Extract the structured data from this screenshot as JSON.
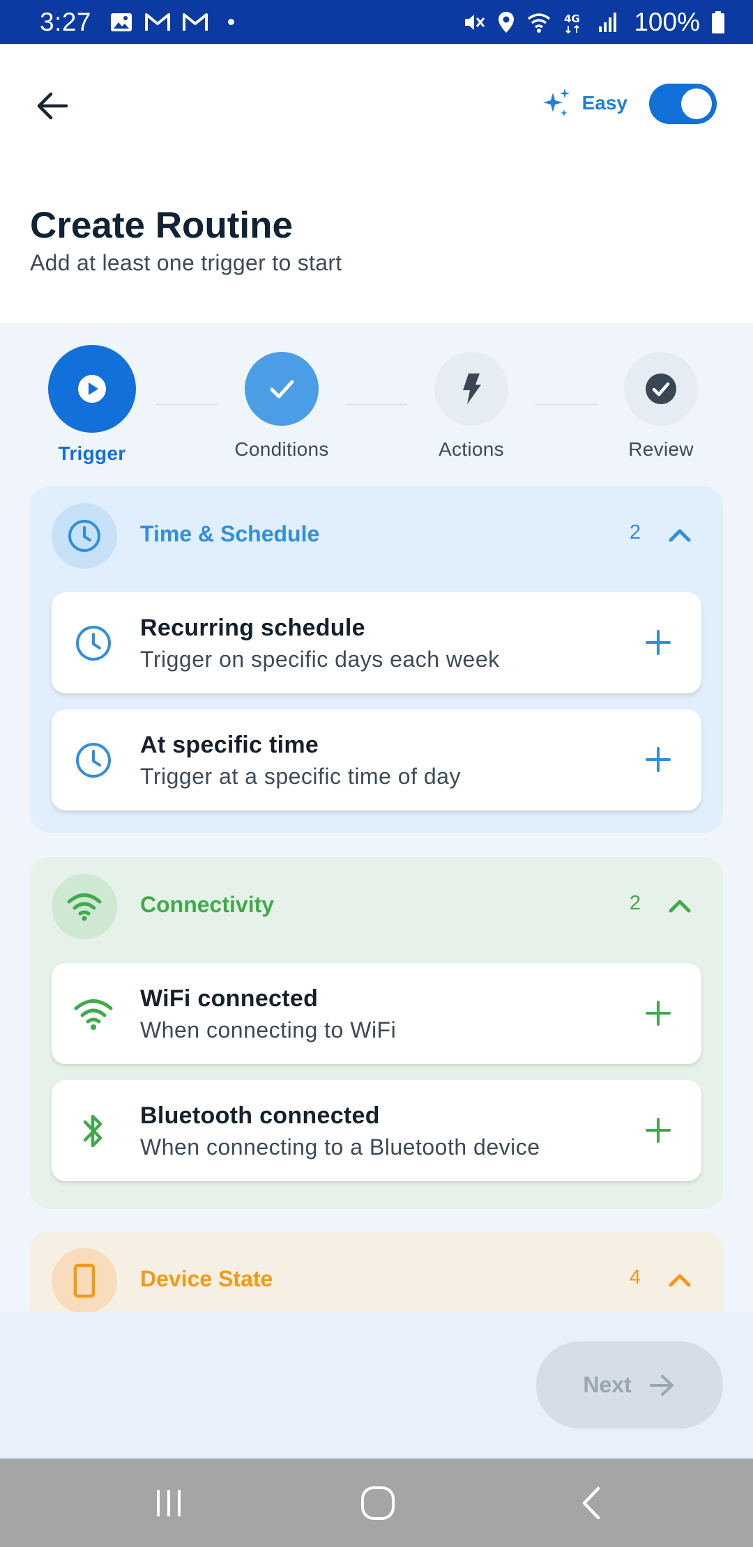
{
  "status_bar": {
    "time": "3:27",
    "battery": "100%",
    "icons": [
      "image-icon",
      "gmail-icon",
      "gmail-icon",
      "dot",
      "mute-icon",
      "location-icon",
      "wifi-icon",
      "4g-icon",
      "signal-icon",
      "battery-icon"
    ]
  },
  "header": {
    "easy_label": "Easy",
    "easy_toggle_on": true,
    "title": "Create Routine",
    "subtitle": "Add at least one trigger to start"
  },
  "stepper": {
    "steps": [
      {
        "label": "Trigger",
        "state": "active",
        "icon": "play-icon"
      },
      {
        "label": "Conditions",
        "state": "done",
        "icon": "check-icon"
      },
      {
        "label": "Actions",
        "state": "pending",
        "icon": "bolt-icon"
      },
      {
        "label": "Review",
        "state": "pending",
        "icon": "check-circle-icon"
      }
    ]
  },
  "sections": [
    {
      "title": "Time & Schedule",
      "count": "2",
      "icon": "clock-icon",
      "color": "#2f8fdf",
      "bg": "#e1eefb",
      "icon_bg": "#c6e1f8",
      "items": [
        {
          "title": "Recurring schedule",
          "desc": "Trigger on specific days each week",
          "icon": "clock-icon"
        },
        {
          "title": "At specific time",
          "desc": "Trigger at a specific time of day",
          "icon": "clock-icon"
        }
      ]
    },
    {
      "title": "Connectivity",
      "count": "2",
      "icon": "wifi-icon",
      "color": "#3faa4a",
      "bg": "#e6f2e9",
      "icon_bg": "#cfe8d4",
      "items": [
        {
          "title": "WiFi connected",
          "desc": "When connecting to WiFi",
          "icon": "wifi-icon"
        },
        {
          "title": "Bluetooth connected",
          "desc": "When connecting to a Bluetooth device",
          "icon": "bluetooth-icon"
        }
      ]
    },
    {
      "title": "Device State",
      "count": "4",
      "icon": "phone-icon",
      "color": "#f29a17",
      "bg": "#f6efe3",
      "icon_bg": "#f8dcbb"
    }
  ],
  "footer": {
    "next_label": "Next"
  }
}
